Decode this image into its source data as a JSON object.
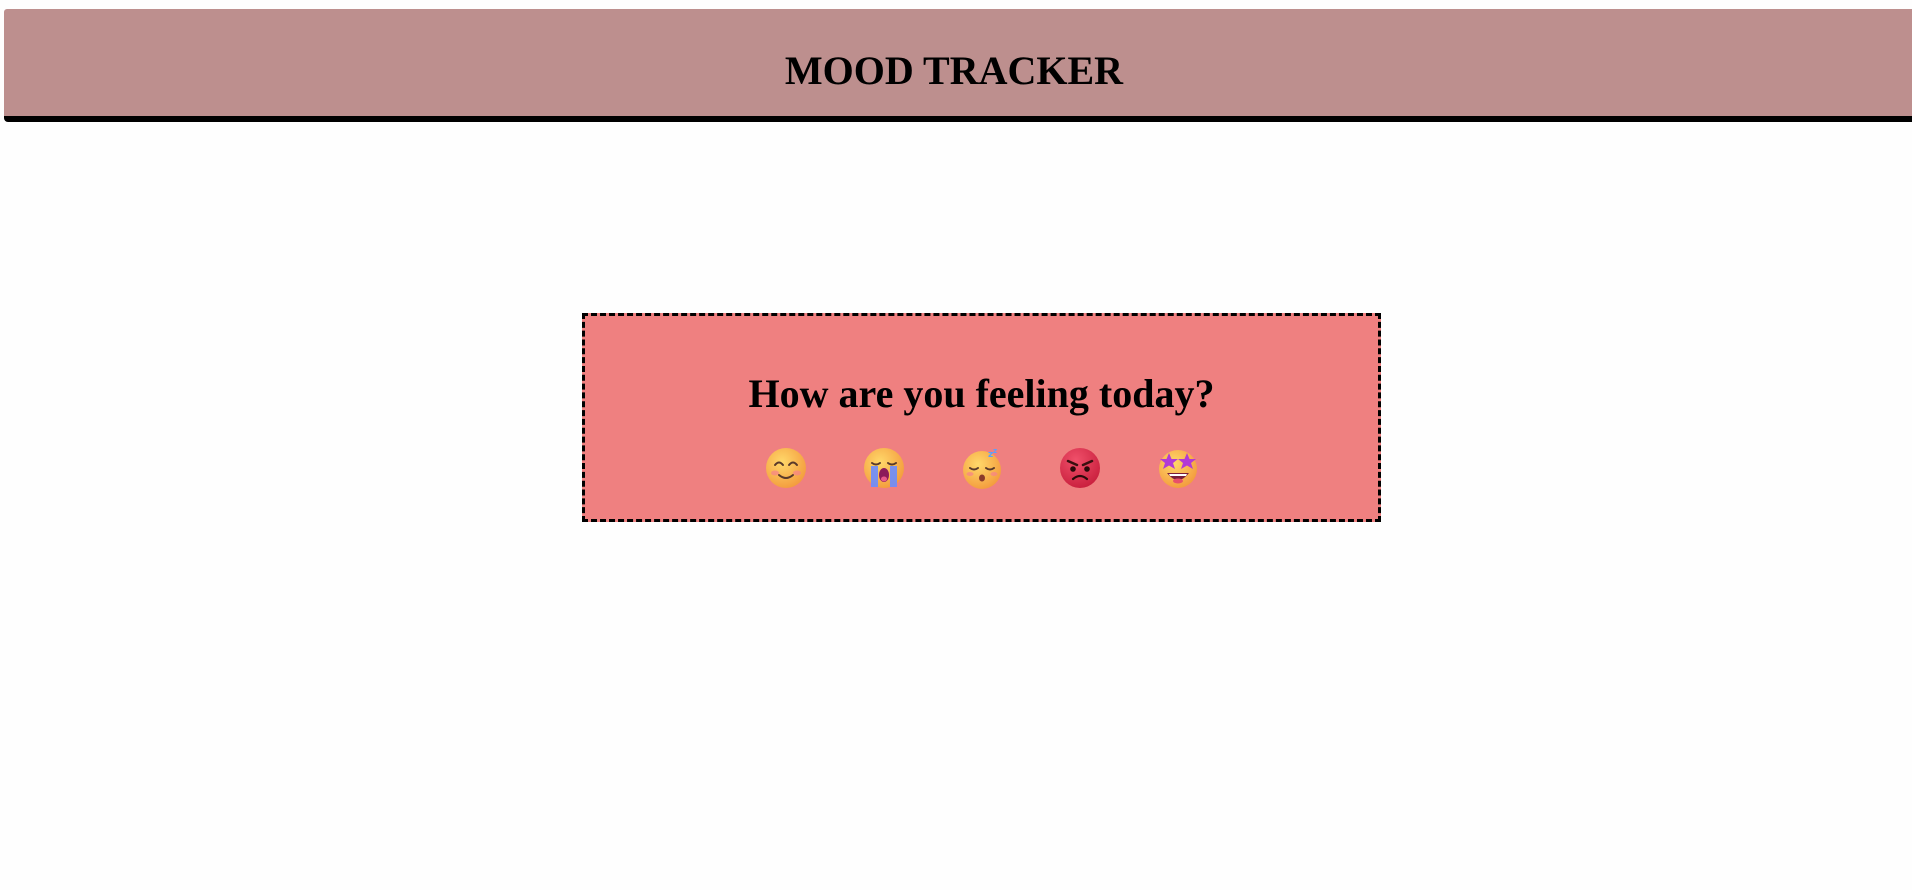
{
  "header": {
    "title": "MOOD TRACKER"
  },
  "card": {
    "question": "How are you feeling today?",
    "moods": [
      {
        "name": "smiling-face",
        "icon": "smiling-face-icon"
      },
      {
        "name": "crying-face",
        "icon": "crying-face-icon"
      },
      {
        "name": "sleeping-face",
        "icon": "sleeping-face-icon"
      },
      {
        "name": "angry-face",
        "icon": "angry-face-icon"
      },
      {
        "name": "star-struck-face",
        "icon": "star-struck-face-icon"
      }
    ]
  },
  "colors": {
    "header_bg": "#bd8f8e",
    "card_bg": "#ef8080",
    "page_bg": "#fefefe"
  }
}
